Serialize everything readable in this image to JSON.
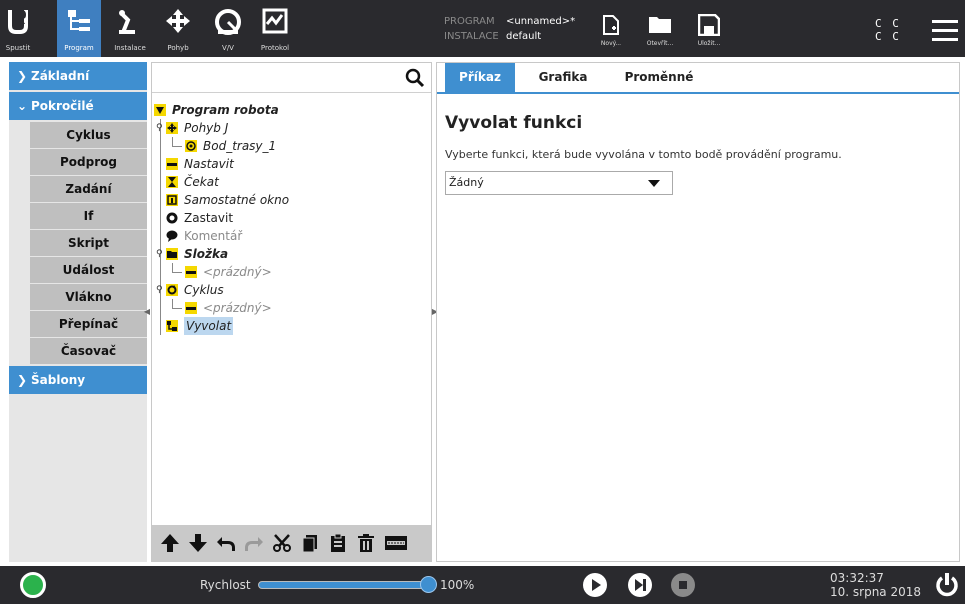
{
  "nav": {
    "items": [
      {
        "label": "Spustit",
        "icon": "ur-logo-icon"
      },
      {
        "label": "Program",
        "icon": "program-tree-icon",
        "active": true
      },
      {
        "label": "Instalace",
        "icon": "robot-arm-icon"
      },
      {
        "label": "Pohyb",
        "icon": "move-arrows-icon"
      },
      {
        "label": "V/V",
        "icon": "io-gauge-icon"
      },
      {
        "label": "Protokol",
        "icon": "log-chart-icon"
      }
    ]
  },
  "program_info": {
    "program_key": "PROGRAM",
    "program_value": "<unnamed>*",
    "install_key": "INSTALACE",
    "install_value": "default"
  },
  "file_buttons": [
    {
      "label": "Nový...",
      "icon": "new-file-icon"
    },
    {
      "label": "Otevřít...",
      "icon": "open-folder-icon"
    },
    {
      "label": "Uložit...",
      "icon": "save-icon"
    }
  ],
  "cc_indicator": {
    "line1": "C C",
    "line2": "C C"
  },
  "sidebar": {
    "categories": [
      {
        "label": "Základní",
        "expanded": false
      },
      {
        "label": "Pokročilé",
        "expanded": true
      },
      {
        "label": "Šablony",
        "expanded": false
      }
    ],
    "advanced_items": [
      "Cyklus",
      "Podprog",
      "Zadání",
      "If",
      "Skript",
      "Událost",
      "Vlákno",
      "Přepínač",
      "Časovač"
    ]
  },
  "tree": {
    "root": "Program robota",
    "nodes": [
      {
        "label": "Pohyb J",
        "icon": "move-icon"
      },
      {
        "label": "Bod_trasy_1",
        "icon": "waypoint-icon"
      },
      {
        "label": "Nastavit",
        "icon": "set-icon"
      },
      {
        "label": "Čekat",
        "icon": "hourglass-icon"
      },
      {
        "label": "Samostatné okno",
        "icon": "popup-icon"
      },
      {
        "label": "Zastavit",
        "icon": "halt-icon"
      },
      {
        "label": "Komentář",
        "icon": "comment-icon"
      },
      {
        "label": "Složka",
        "icon": "folder-icon"
      },
      {
        "label": "<prázdný>",
        "icon": "empty-icon"
      },
      {
        "label": "Cyklus",
        "icon": "loop-icon"
      },
      {
        "label": "<prázdný>",
        "icon": "empty-icon"
      },
      {
        "label": "Vyvolat",
        "icon": "call-icon"
      }
    ]
  },
  "toolbar_icons": [
    "move-up-icon",
    "move-down-icon",
    "undo-icon",
    "redo-icon",
    "cut-icon",
    "copy-icon",
    "paste-icon",
    "delete-icon",
    "suppress-icon"
  ],
  "tabs": [
    "Příkaz",
    "Grafika",
    "Proměnné"
  ],
  "command": {
    "title": "Vyvolat funkci",
    "description": "Vyberte funkci, která bude vyvolána v tomto bodě provádění programu.",
    "select_value": "Žádný"
  },
  "footer": {
    "speed_label": "Rychlost",
    "speed_value": "100%",
    "speed_fraction": 1.0,
    "time": "03:32:37",
    "date": "10. srpna 2018"
  },
  "colors": {
    "accent": "#3f8fd0",
    "topbar": "#2a2a2e",
    "status_green": "#2bb24c",
    "tree_icon_yellow": "#f5d800"
  }
}
